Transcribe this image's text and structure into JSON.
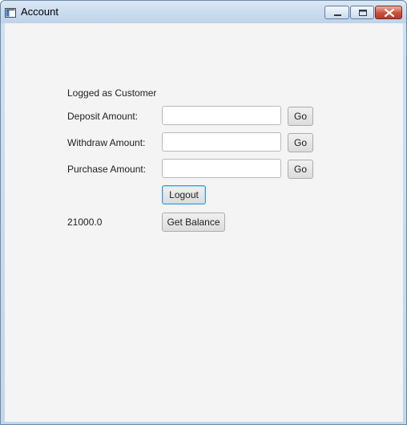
{
  "window": {
    "title": "Account",
    "controls": [
      "minimize-icon",
      "maximize-icon",
      "close-icon"
    ]
  },
  "form": {
    "status_text": "Logged as Customer",
    "deposit": {
      "label": "Deposit Amount:",
      "value": "",
      "button": "Go"
    },
    "withdraw": {
      "label": "Withdraw Amount:",
      "value": "",
      "button": "Go"
    },
    "purchase": {
      "label": "Purchase Amount:",
      "value": "",
      "button": "Go"
    },
    "logout_label": "Logout",
    "balance_value": "21000.0",
    "get_balance_label": "Get Balance"
  }
}
